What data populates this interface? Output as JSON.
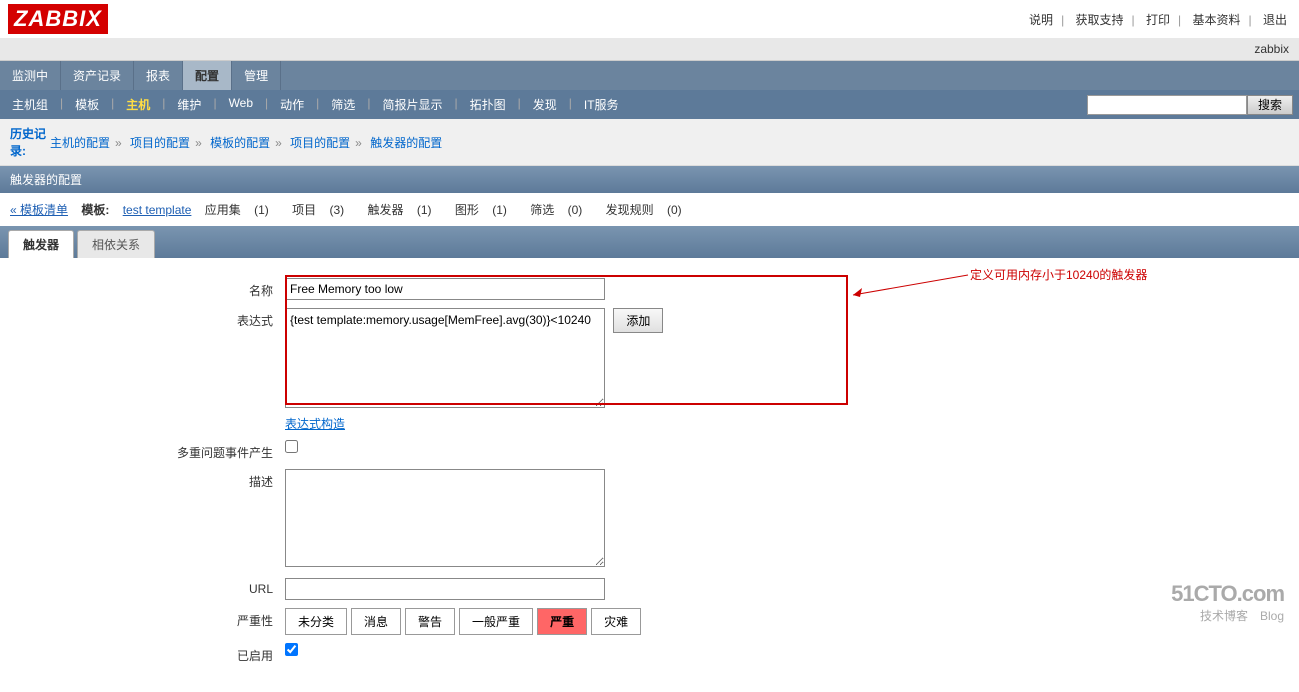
{
  "logo": "ZABBIX",
  "top_links": [
    "说明",
    "获取支持",
    "打印",
    "基本资料",
    "退出"
  ],
  "user": "zabbix",
  "nav1": [
    {
      "label": "监测中",
      "active": false
    },
    {
      "label": "资产记录",
      "active": false
    },
    {
      "label": "报表",
      "active": false
    },
    {
      "label": "配置",
      "active": true
    },
    {
      "label": "管理",
      "active": false
    }
  ],
  "nav2": [
    {
      "label": "主机组",
      "active": false
    },
    {
      "label": "模板",
      "active": false
    },
    {
      "label": "主机",
      "active": true
    },
    {
      "label": "维护",
      "active": false
    },
    {
      "label": "Web",
      "active": false
    },
    {
      "label": "动作",
      "active": false
    },
    {
      "label": "筛选",
      "active": false
    },
    {
      "label": "简报片显示",
      "active": false
    },
    {
      "label": "拓扑图",
      "active": false
    },
    {
      "label": "发现",
      "active": false
    },
    {
      "label": "IT服务",
      "active": false
    }
  ],
  "search_btn": "搜索",
  "history_label": "历史记录:",
  "crumbs": [
    "主机的配置",
    "项目的配置",
    "模板的配置",
    "项目的配置",
    "触发器的配置"
  ],
  "page_header": "触发器的配置",
  "subnav": {
    "back": "« 模板清单",
    "template_label": "模板:",
    "template_name": "test template",
    "items": [
      {
        "label": "应用集",
        "count": "(1)"
      },
      {
        "label": "项目",
        "count": "(3)"
      },
      {
        "label": "触发器",
        "count": "(1)"
      },
      {
        "label": "图形",
        "count": "(1)"
      },
      {
        "label": "筛选",
        "count": "(0)"
      },
      {
        "label": "发现规则",
        "count": "(0)"
      }
    ]
  },
  "tabs": [
    {
      "label": "触发器",
      "active": true
    },
    {
      "label": "相依关系",
      "active": false
    }
  ],
  "form": {
    "name_label": "名称",
    "name_value": "Free Memory too low",
    "expr_label": "表达式",
    "expr_value": "{test template:memory.usage[MemFree].avg(30)}<10240",
    "add_btn": "添加",
    "expr_builder": "表达式构造",
    "multi_label": "多重问题事件产生",
    "desc_label": "描述",
    "url_label": "URL",
    "severity_label": "严重性",
    "severities": [
      "未分类",
      "消息",
      "警告",
      "一般严重",
      "严重",
      "灾难"
    ],
    "severity_selected": 4,
    "enabled_label": "已启用"
  },
  "annotation": "定义可用内存小于10240的触发器",
  "watermark": {
    "line1": "51CTO.com",
    "line2": "技术博客　Blog"
  }
}
